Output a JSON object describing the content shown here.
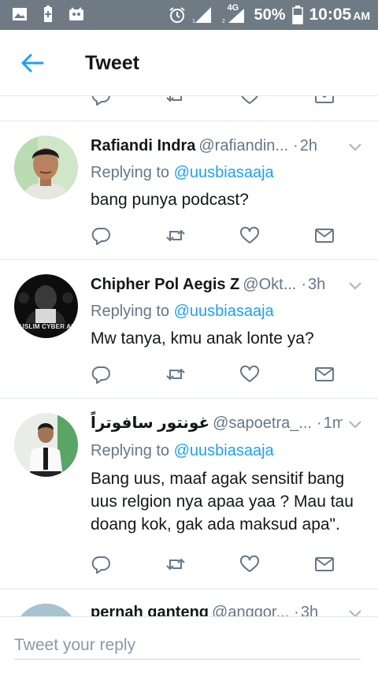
{
  "status_bar": {
    "network": "4G",
    "battery": "50%",
    "time": "10:05",
    "ampm": "AM"
  },
  "header": {
    "title": "Tweet"
  },
  "replies": [
    {
      "name": "Rafiandi Indra",
      "handle": "@rafiandin...",
      "time": "2h",
      "replying_prefix": "Replying to ",
      "replying_to": "@uusbiasaaja",
      "text": "bang punya podcast?"
    },
    {
      "name": "Chipher Pol Aegis Z",
      "handle": "@Okt...",
      "time": "3h",
      "replying_prefix": "Replying to ",
      "replying_to": "@uusbiasaaja",
      "text": "Mw tanya, kmu anak lonte ya?",
      "avatar_text": "MUSLIM CYBER ARMY"
    },
    {
      "name": "غونتور سافوتراً",
      "handle": "@sapoetra_...",
      "time": "1m",
      "replying_prefix": "Replying to ",
      "replying_to": "@uusbiasaaja",
      "text": "Bang uus, maaf agak sensitif bang uus relgion nya apaa yaa ? Mau tau doang kok, gak ada maksud apa\"."
    },
    {
      "name": "pernah ganteng",
      "handle": "@anggor...",
      "time": "3h"
    }
  ],
  "reply_box": {
    "placeholder": "Tweet your reply"
  },
  "colors": {
    "accent": "#1da1f2",
    "text": "#14171a",
    "muted": "#657786",
    "status_bar": "#6e7b85"
  },
  "icons": [
    "back-arrow-icon",
    "reply-icon",
    "retweet-icon",
    "like-icon",
    "direct-message-icon",
    "chevron-down-icon"
  ]
}
